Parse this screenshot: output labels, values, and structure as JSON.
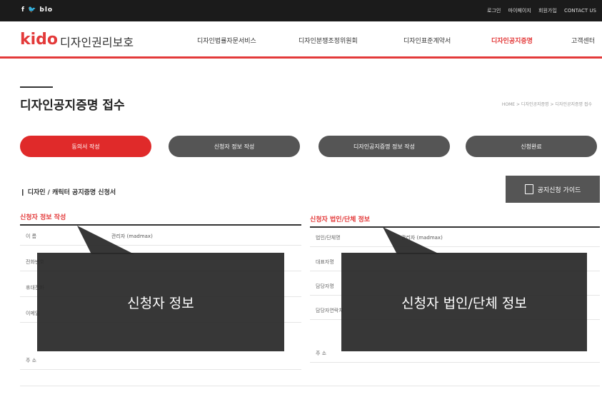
{
  "topbar": {
    "social": "f  🐦  blo",
    "links": [
      "로그인",
      "마이페이지",
      "회원가입",
      "CONTACT US"
    ]
  },
  "header": {
    "logo": "kido",
    "logo_text": "디자인권리보호",
    "nav": [
      "디자인법률자문서비스",
      "디자인분쟁조정위원회",
      "디자인표준계약서",
      "디자인공지증명",
      "고객센터"
    ],
    "active_nav": "디자인공지증명"
  },
  "page": {
    "title": "디자인공지증명 접수",
    "breadcrumb": "HOME > 디자인공지증명 > 디자인공지증명 접수"
  },
  "steps": [
    "동의서 작성",
    "신청자 정보 작성",
    "디자인공지증명 정보 작성",
    "신청완료"
  ],
  "form": {
    "title": "디자인 / 캐릭터 공지증명 신청서",
    "guide_button": "공지신청 가이드"
  },
  "left": {
    "section_title": "신청자 정보 작성",
    "rows": [
      {
        "label": "이 름",
        "value": "관리자 (madmax)"
      },
      {
        "label": "전화번호",
        "value": ""
      },
      {
        "label": "휴대전화",
        "value": ""
      },
      {
        "label": "이메일",
        "value": ""
      },
      {
        "label": "주 소",
        "value": ""
      }
    ],
    "overlay": "신청자 정보"
  },
  "right": {
    "section_title": "신청자 법인/단체 정보",
    "rows": [
      {
        "label": "법인/단체명",
        "value": "관리자 (madmax)"
      },
      {
        "label": "대표자명",
        "value": ""
      },
      {
        "label": "담당자명",
        "value": ""
      },
      {
        "label": "담당자연락처",
        "value": ""
      },
      {
        "label": "주 소",
        "value": ""
      }
    ],
    "overlay": "신청자 법인/단체 정보"
  }
}
